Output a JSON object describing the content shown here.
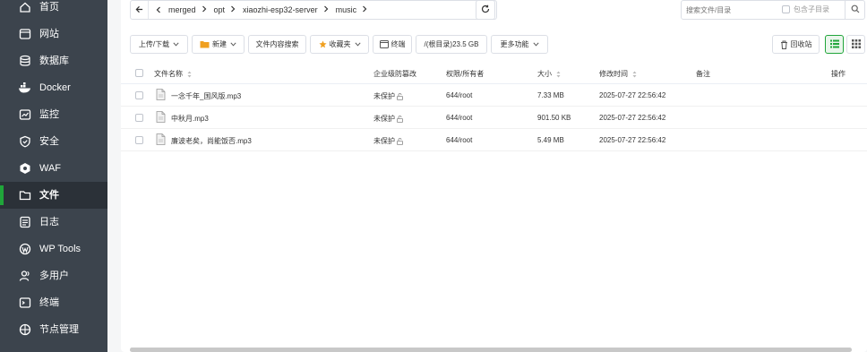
{
  "sidebar": {
    "items": [
      {
        "label": "首页",
        "icon": "home-icon"
      },
      {
        "label": "网站",
        "icon": "website-icon"
      },
      {
        "label": "数据库",
        "icon": "database-icon"
      },
      {
        "label": "Docker",
        "icon": "docker-icon"
      },
      {
        "label": "监控",
        "icon": "monitor-icon"
      },
      {
        "label": "安全",
        "icon": "shield-icon"
      },
      {
        "label": "WAF",
        "icon": "waf-icon"
      },
      {
        "label": "文件",
        "icon": "folder-icon",
        "active": true
      },
      {
        "label": "日志",
        "icon": "log-icon"
      },
      {
        "label": "WP Tools",
        "icon": "wordpress-icon"
      },
      {
        "label": "多用户",
        "icon": "users-icon"
      },
      {
        "label": "终端",
        "icon": "terminal-icon"
      },
      {
        "label": "节点管理",
        "icon": "node-icon"
      }
    ]
  },
  "path": {
    "crumbs": [
      "merged",
      "opt",
      "xiaozhi-esp32-server",
      "music"
    ]
  },
  "search": {
    "placeholder": "搜索文件/目录",
    "subdir_label": "包含子目录"
  },
  "toolbar": {
    "upload": "上传/下载",
    "new": "新建",
    "content_search": "文件内容搜索",
    "favorites": "收藏夹",
    "terminal": "终端",
    "disk": "/(根目录)23.5 GB",
    "more": "更多功能",
    "recycle": "回收站"
  },
  "table": {
    "headers": {
      "name": "文件名称",
      "protect": "企业级防篡改",
      "perm": "权限/所有者",
      "size": "大小",
      "mtime": "修改时间",
      "note": "备注",
      "action": "操作"
    },
    "rows": [
      {
        "name": "一念千年_国风版.mp3",
        "protect": "未保护",
        "perm": "644/root",
        "size": "7.33 MB",
        "mtime": "2025-07-27 22:56:42"
      },
      {
        "name": "中秋月.mp3",
        "protect": "未保护",
        "perm": "644/root",
        "size": "901.50 KB",
        "mtime": "2025-07-27 22:56:42"
      },
      {
        "name": "廉波老矣，尚能饭否.mp3",
        "protect": "未保护",
        "perm": "644/root",
        "size": "5.49 MB",
        "mtime": "2025-07-27 22:56:42"
      }
    ]
  },
  "colors": {
    "sidebar_bg": "#3c444d",
    "accent": "#20a53a",
    "star": "#f0a020"
  }
}
